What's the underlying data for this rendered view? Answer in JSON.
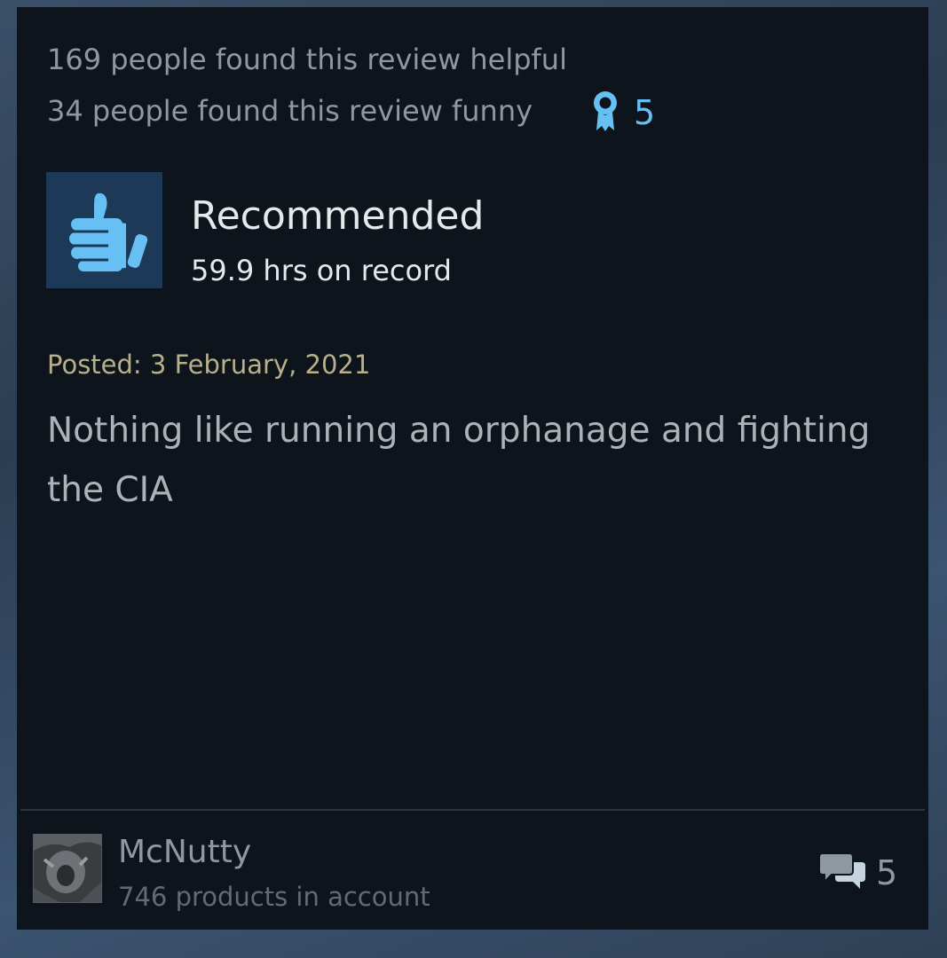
{
  "review": {
    "helpful_text": "169 people found this review helpful",
    "funny_text": "34 people found this review funny",
    "award_count": "5",
    "recommendation": "Recommended",
    "hours": "59.9 hrs on record",
    "posted": "Posted: 3 February, 2021",
    "body": "Nothing like running an orphanage and fighting the CIA",
    "icons": {
      "thumb": "thumbs-up-icon",
      "award": "award-ribbon-icon",
      "comments": "comments-icon"
    }
  },
  "author": {
    "name": "McNutty",
    "products": "746 products in account",
    "comment_count": "5"
  },
  "colors": {
    "accent": "#66c0f4",
    "card_bg": "#0e141b",
    "thumb_bg": "#1c3a57",
    "posted": "#b7b08a"
  }
}
